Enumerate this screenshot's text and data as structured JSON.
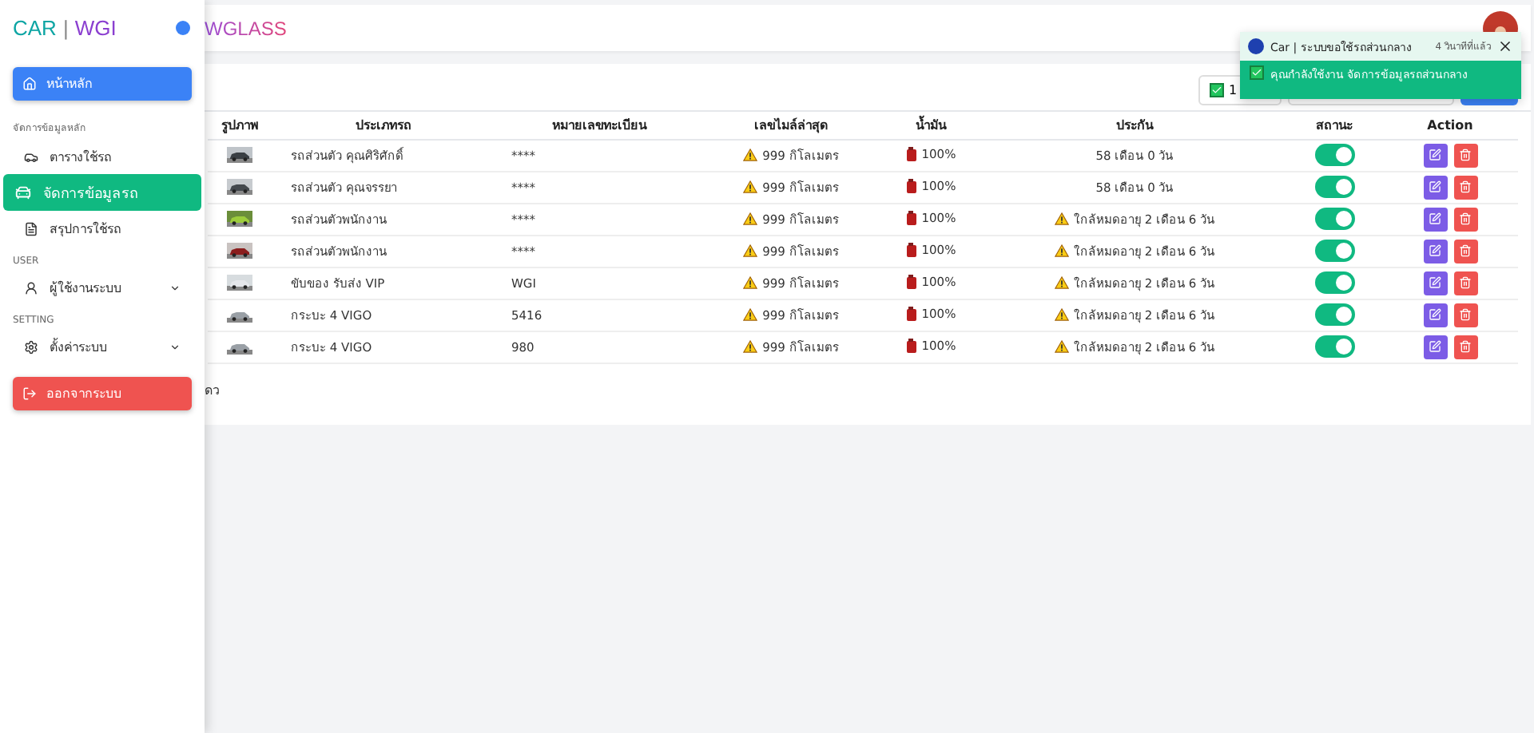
{
  "sidebar": {
    "logo": {
      "left": "CAR",
      "separator": "|",
      "right": "WGI"
    },
    "items": [
      {
        "kind": "button",
        "label": "หน้าหลัก",
        "color": "#3b82f6",
        "selected": false
      },
      {
        "kind": "section",
        "label": "จัดการข้อมูลหลัก"
      },
      {
        "kind": "item",
        "label": "ตารางใช้รถ",
        "selected": false
      },
      {
        "kind": "item",
        "label": "จัดการข้อมูลรถ",
        "selected": true
      },
      {
        "kind": "item",
        "label": "สรุปการใช้รถ",
        "selected": false
      },
      {
        "kind": "section",
        "label": "USER"
      },
      {
        "kind": "item",
        "label": "ผู้ใช้งานระบบ",
        "selected": false,
        "expanded": false
      },
      {
        "kind": "section",
        "label": "SETTING"
      },
      {
        "kind": "item",
        "label": "ตั้งค่าระบบ",
        "selected": false,
        "expanded": false
      },
      {
        "kind": "button",
        "label": "ออกจากระบบ",
        "color": "#ef5350",
        "selected": false
      }
    ]
  },
  "header": {
    "title": "WGLASS"
  },
  "toolbar": {
    "filter_button": "1"
  },
  "table": {
    "columns": [
      "รูปภาพ",
      "ประเภทรถ",
      "หมายเลขทะเบียน",
      "เลขไมล์ล่าสุด",
      "น้ำมัน",
      "ประกัน",
      "สถานะ",
      "Action"
    ],
    "rows": [
      {
        "type": "รถส่วนตัว คุณศิริศักดิ์",
        "plate": "****",
        "mileage": "999 กิโลเมตร",
        "fuel": "100%",
        "insurance": "58 เดือน 0 วัน",
        "insurance_warning": false,
        "on": true
      },
      {
        "type": "รถส่วนตัว คุณจรรยา",
        "plate": "****",
        "mileage": "999 กิโลเมตร",
        "fuel": "100%",
        "insurance": "58 เดือน 0 วัน",
        "insurance_warning": false,
        "on": true
      },
      {
        "type": "รถส่วนตัวพนักงาน",
        "plate": "****",
        "mileage": "999 กิโลเมตร",
        "fuel": "100%",
        "insurance": "ใกล้หมดอายุ 2 เดือน 6 วัน",
        "insurance_warning": true,
        "on": true
      },
      {
        "type": "รถส่วนตัวพนักงาน",
        "plate": "****",
        "mileage": "999 กิโลเมตร",
        "fuel": "100%",
        "insurance": "ใกล้หมดอายุ 2 เดือน 6 วัน",
        "insurance_warning": true,
        "on": true
      },
      {
        "type": "ขับของ รับส่ง VIP",
        "plate": "WGI",
        "mileage": "999 กิโลเมตร",
        "fuel": "100%",
        "insurance": "ใกล้หมดอายุ 2 เดือน 6 วัน",
        "insurance_warning": true,
        "on": true
      },
      {
        "type": "กระบะ 4 VIGO",
        "plate": "5416",
        "mileage": "999 กิโลเมตร",
        "fuel": "100%",
        "insurance": "ใกล้หมดอายุ 2 เดือน 6 วัน",
        "insurance_warning": true,
        "on": true
      },
      {
        "type": "กระบะ 4 VIGO",
        "plate": "980",
        "mileage": "999 กิโลเมตร",
        "fuel": "100%",
        "insurance": "ใกล้หมดอายุ 2 เดือน 6 วัน",
        "insurance_warning": true,
        "on": true
      }
    ]
  },
  "footer": {
    "text": "ดว"
  },
  "toast": {
    "title": "Car | ระบบขอใช้รถส่วนกลาง",
    "time": "4 วินาทีที่แล้ว",
    "message": "คุณกำลังใช้งาน จัดการข้อมูลรถส่วนกลาง"
  }
}
